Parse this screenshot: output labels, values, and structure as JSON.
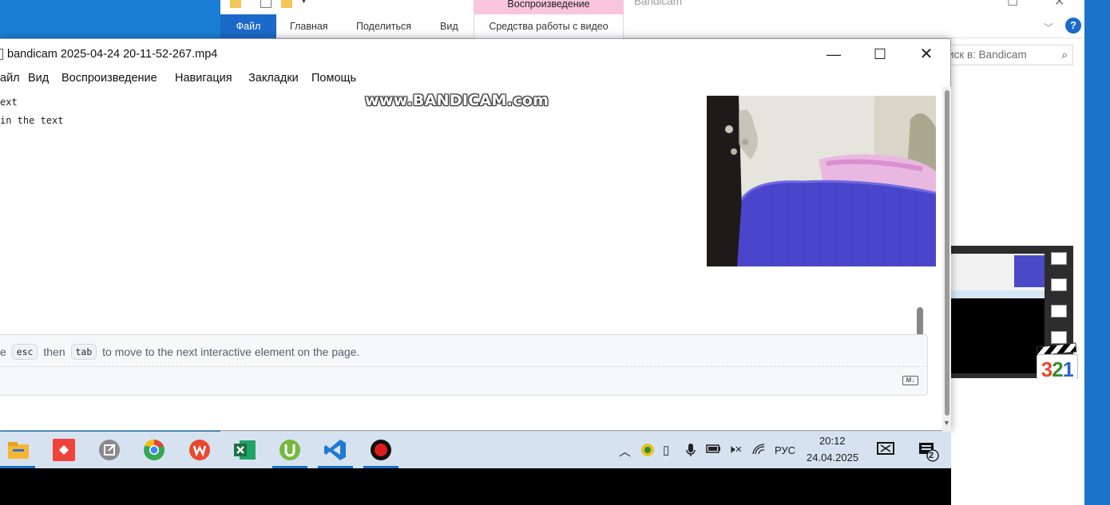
{
  "explorer": {
    "contextual_tab_group": "Воспроизведение",
    "window_title": "Bandicam",
    "tabs": [
      {
        "label": "Файл"
      },
      {
        "label": "Главная"
      },
      {
        "label": "Поделиться"
      },
      {
        "label": "Вид"
      },
      {
        "label": "Средства работы с видео"
      }
    ],
    "search_placeholder": "иск в: Bandicam",
    "help_label": "?",
    "thumbnail_badge": "321"
  },
  "player": {
    "title": "bandicam 2025-04-24 20-11-52-267.mp4",
    "menu": [
      "айл",
      "Вид",
      "Воспроизведение",
      "Навигация",
      "Закладки",
      "Помощь"
    ],
    "watermark": "www.BANDICAM.com",
    "code_lines": [
      "ext",
      "in the text"
    ],
    "hint": {
      "prefix": "e",
      "key1": "esc",
      "middle": "then",
      "key2": "tab",
      "suffix": "to move to the next interactive element on the page."
    },
    "markdown_badge": "M↓"
  },
  "taskbar": {
    "apps": [
      {
        "name": "file-explorer",
        "color": "#f2b632"
      },
      {
        "name": "anydesk",
        "color": "#ef443b"
      },
      {
        "name": "notepad-app",
        "color": "#8a8a8a"
      },
      {
        "name": "chrome",
        "color": "#4285f4"
      },
      {
        "name": "wps-office",
        "color": "#e8492f"
      },
      {
        "name": "excel",
        "color": "#1d7044"
      },
      {
        "name": "utorrent",
        "color": "#76b83f"
      },
      {
        "name": "vscode",
        "color": "#1f7ad1"
      },
      {
        "name": "bandicam",
        "color": "#e01b1b"
      }
    ],
    "language": "РУС",
    "time": "20:12",
    "date": "24.04.2025",
    "notification_count": "2"
  }
}
